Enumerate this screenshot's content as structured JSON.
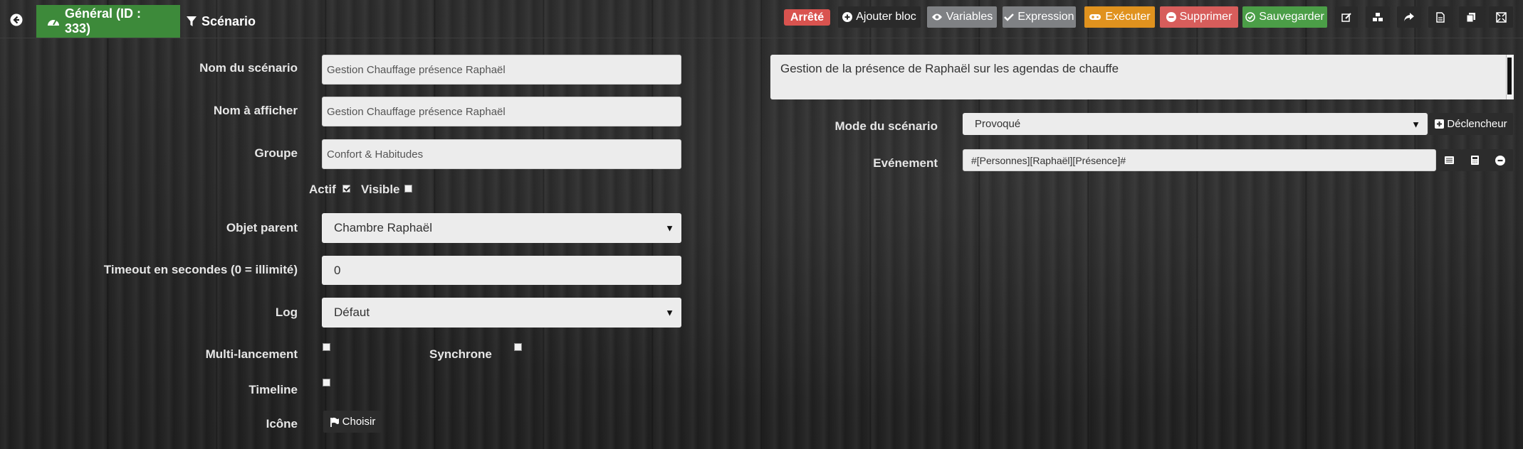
{
  "topbar": {
    "tabs": [
      {
        "label": "Général (ID : 333)"
      },
      {
        "label": "Scénario"
      }
    ],
    "status": "Arrêté",
    "buttons": {
      "add_block": "Ajouter bloc",
      "variables": "Variables",
      "expression": "Expression",
      "execute": "Exécuter",
      "delete": "Supprimer",
      "save": "Sauvegarder"
    },
    "colors": {
      "active_tab": "#3d8a3a",
      "status": "#d9534f",
      "execute": "#e0921e",
      "delete": "#d75d5b",
      "save": "#4b9e47",
      "grey": "#7f8184"
    }
  },
  "form": {
    "name": {
      "label": "Nom du scénario",
      "value": "Gestion Chauffage présence Raphaël"
    },
    "display_name": {
      "label": "Nom à afficher",
      "value": "Gestion Chauffage présence Raphaël"
    },
    "group": {
      "label": "Groupe",
      "value": "Confort & Habitudes"
    },
    "active": {
      "label": "Actif",
      "checked": true
    },
    "visible": {
      "label": "Visible",
      "checked": false
    },
    "parent": {
      "label": "Objet parent",
      "value": "Chambre Raphaël"
    },
    "timeout": {
      "label": "Timeout en secondes (0 = illimité)",
      "value": "0"
    },
    "log": {
      "label": "Log",
      "value": "Défaut"
    },
    "multi_launch": {
      "label": "Multi-lancement",
      "checked": false
    },
    "synchronous": {
      "label": "Synchrone",
      "checked": false
    },
    "timeline": {
      "label": "Timeline",
      "checked": false
    },
    "icon": {
      "label": "Icône",
      "button": "Choisir"
    }
  },
  "right": {
    "description": "Gestion de la présence de Raphaël sur les agendas de chauffe",
    "mode": {
      "label": "Mode du scénario",
      "value": "Provoqué",
      "trigger_button": "Déclencheur"
    },
    "event": {
      "label": "Evénement",
      "value": "#[Personnes][Raphaël][Présence]#"
    }
  }
}
